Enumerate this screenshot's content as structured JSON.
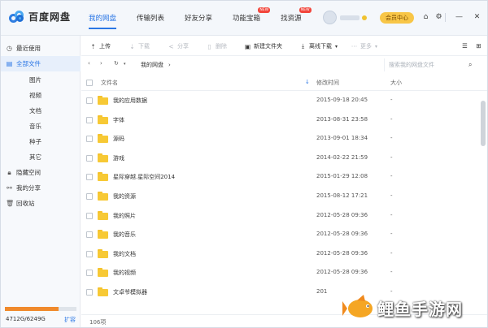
{
  "app": {
    "logo_text": "百度网盘"
  },
  "nav": [
    {
      "label": "我的网盘",
      "active": true,
      "badge": ""
    },
    {
      "label": "传输列表",
      "active": false,
      "badge": ""
    },
    {
      "label": "好友分享",
      "active": false,
      "badge": ""
    },
    {
      "label": "功能宝箱",
      "active": false,
      "badge": "NEW"
    },
    {
      "label": "找资源",
      "active": false,
      "badge": "NEW"
    }
  ],
  "header": {
    "vip_label": "会员中心",
    "icons": [
      "shirt-icon",
      "gear-icon",
      "minimize-icon",
      "close-icon"
    ]
  },
  "sidebar": {
    "items": [
      {
        "label": "最近使用",
        "icon": "clock-icon",
        "sub": false,
        "active": false
      },
      {
        "label": "全部文件",
        "icon": "file-icon",
        "sub": false,
        "active": true
      },
      {
        "label": "图片",
        "icon": "",
        "sub": true,
        "active": false
      },
      {
        "label": "视频",
        "icon": "",
        "sub": true,
        "active": false
      },
      {
        "label": "文档",
        "icon": "",
        "sub": true,
        "active": false
      },
      {
        "label": "音乐",
        "icon": "",
        "sub": true,
        "active": false
      },
      {
        "label": "种子",
        "icon": "",
        "sub": true,
        "active": false
      },
      {
        "label": "其它",
        "icon": "",
        "sub": true,
        "active": false
      },
      {
        "label": "隐藏空间",
        "icon": "lock-icon",
        "sub": false,
        "active": false
      },
      {
        "label": "我的分享",
        "icon": "share-icon",
        "sub": false,
        "active": false
      },
      {
        "label": "回收站",
        "icon": "trash-icon",
        "sub": false,
        "active": false
      }
    ],
    "quota_text": "4712G/6249G",
    "quota_fraction": 0.754,
    "expand_label": "扩容"
  },
  "toolbar": {
    "upload": "上传",
    "download": "下载",
    "share": "分享",
    "delete": "删除",
    "new_folder": "新建文件夹",
    "offline": "离线下载",
    "more": "更多"
  },
  "pathbar": {
    "path": "我的网盘",
    "search_placeholder": "搜索我的网盘文件"
  },
  "table": {
    "headers": {
      "name": "文件名",
      "modified": "修改时间",
      "size": "大小"
    },
    "rows": [
      {
        "name": "我的应用数据",
        "modified": "2015-09-18 20:45",
        "size": "-"
      },
      {
        "name": "字体",
        "modified": "2013-08-31 23:58",
        "size": "-"
      },
      {
        "name": "源码",
        "modified": "2013-09-01 18:34",
        "size": "-"
      },
      {
        "name": "游戏",
        "modified": "2014-02-22 21:59",
        "size": "-"
      },
      {
        "name": "星际穿越.星际空间2014",
        "modified": "2015-01-29 12:08",
        "size": "-"
      },
      {
        "name": "我的资源",
        "modified": "2015-08-12 17:21",
        "size": "-"
      },
      {
        "name": "我的照片",
        "modified": "2012-05-28 09:36",
        "size": "-"
      },
      {
        "name": "我的音乐",
        "modified": "2012-05-28 09:36",
        "size": "-"
      },
      {
        "name": "我的文档",
        "modified": "2012-05-28 09:36",
        "size": "-"
      },
      {
        "name": "我的视频",
        "modified": "2012-05-28 09:36",
        "size": "-"
      },
      {
        "name": "文卓爷模拟器",
        "modified": "201",
        "size": "-"
      }
    ]
  },
  "status": {
    "count": "106项"
  },
  "watermark": {
    "text": "鲤鱼手游网"
  },
  "colors": {
    "accent": "#2a76e5",
    "folder": "#f7c935",
    "vip": "#f8c647",
    "badge": "#f2463c",
    "quota": "#f08a2c",
    "watermark_fish": "#f5a623"
  }
}
